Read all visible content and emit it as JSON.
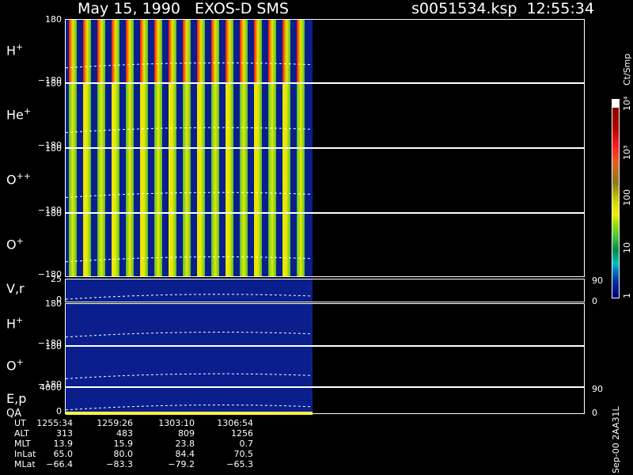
{
  "header": {
    "title": "May 15, 1990   EXOS-D SMS",
    "file": "s0051534.ksp  12:55:34"
  },
  "panels": [
    {
      "label": "H",
      "sup": "+",
      "top_tick": "180",
      "bottom_tick": "−180"
    },
    {
      "label": "He",
      "sup": "+",
      "top_tick": "180",
      "bottom_tick": "−180"
    },
    {
      "label": "O",
      "sup": "++",
      "top_tick": "180",
      "bottom_tick": "−180"
    },
    {
      "label": "O",
      "sup": "+",
      "top_tick": "180",
      "bottom_tick": "−180"
    },
    {
      "label": "V,r",
      "sup": "",
      "top_tick": "25",
      "bottom_tick": "0",
      "right_top": "90",
      "right_bottom": "0"
    },
    {
      "label": "H",
      "sup": "+",
      "top_tick": "180",
      "bottom_tick": "−180"
    },
    {
      "label": "O",
      "sup": "+",
      "top_tick": "180",
      "bottom_tick": "−180"
    },
    {
      "label": "E,p",
      "sup": "",
      "top_tick": "4000",
      "bottom_tick": "0",
      "right_top": "90",
      "right_bottom": "0",
      "extra_label": "QA"
    }
  ],
  "colorbar": {
    "unit": "Ct/Smp",
    "labels": [
      "10⁴",
      "10³",
      "100",
      "10",
      "1"
    ]
  },
  "table": {
    "rows": [
      {
        "label": "UT",
        "values": [
          "1255:34",
          "1259:26",
          "1303:10",
          "1306:54"
        ]
      },
      {
        "label": "ALT",
        "values": [
          "313",
          "483",
          "809",
          "1256"
        ]
      },
      {
        "label": "MLT",
        "values": [
          "13.9",
          "15.9",
          "23.8",
          "0.7"
        ]
      },
      {
        "label": "InLat",
        "values": [
          "65.0",
          "80.0",
          "84.4",
          "70.5"
        ]
      },
      {
        "label": "MLat",
        "values": [
          "−66.4",
          "−83.3",
          "−79.2",
          "−65.3"
        ]
      }
    ]
  },
  "stamp": "Sep-00  2AA31L",
  "colors": {
    "background": "#0a1f8c",
    "stripe_red": "#ff1010",
    "stripe_yellow": "#e8e800",
    "stripe_green": "#50c030",
    "qa_bar": "#ffff40"
  }
}
